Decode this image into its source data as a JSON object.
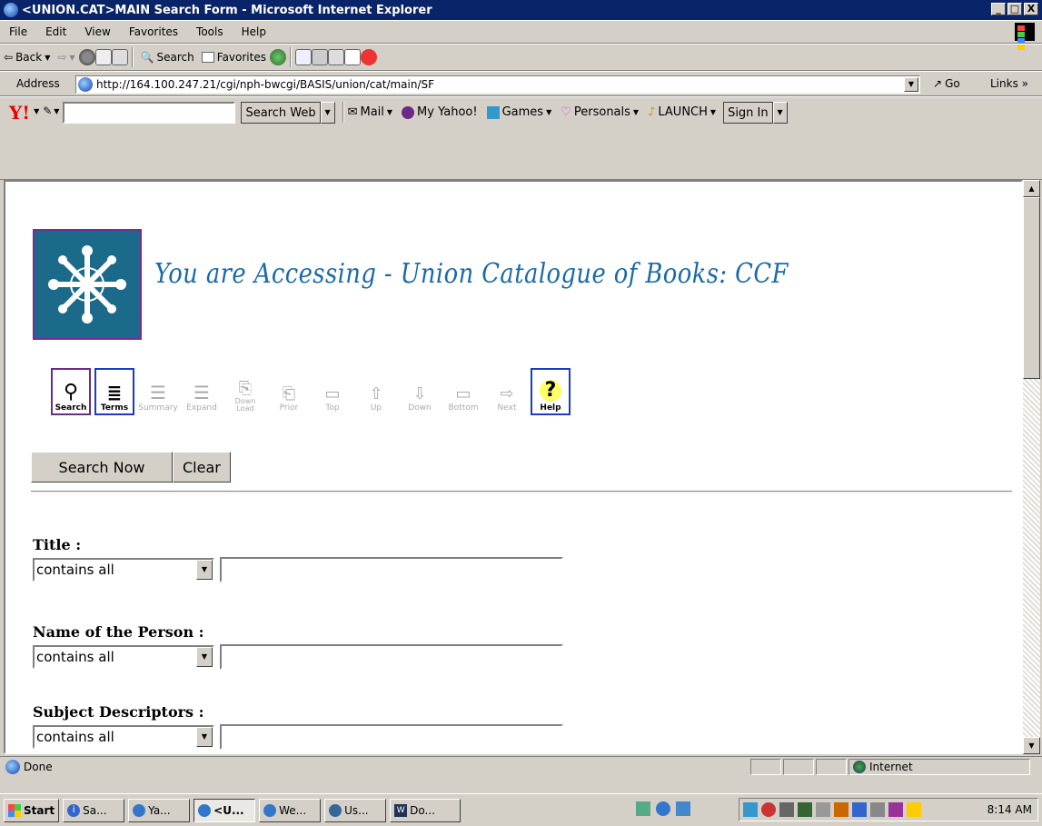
{
  "window": {
    "title": "<UNION.CAT>MAIN Search Form - Microsoft Internet Explorer",
    "min": "_",
    "max": "□",
    "close": "X"
  },
  "menu": [
    "File",
    "Edit",
    "View",
    "Favorites",
    "Tools",
    "Help"
  ],
  "toolbar": {
    "back": "Back",
    "search": "Search",
    "favorites": "Favorites"
  },
  "address": {
    "label": "Address",
    "url": "http://164.100.247.21/cgi/nph-bwcgi/BASIS/union/cat/main/SF",
    "go": "Go",
    "links": "Links"
  },
  "yahoo": {
    "logo": "Y!",
    "search_web": "Search Web",
    "mail": "Mail",
    "my_yahoo": "My Yahoo!",
    "games": "Games",
    "personals": "Personals",
    "launch": "LAUNCH",
    "sign_in": "Sign In"
  },
  "page": {
    "heading": "You are Accessing - Union Catalogue of Books: CCF",
    "tools": [
      {
        "label": "Search",
        "active": true
      },
      {
        "label": "Terms",
        "active": true
      },
      {
        "label": "Summary",
        "active": false
      },
      {
        "label": "Expand",
        "active": false
      },
      {
        "label": "Down Load",
        "active": false
      },
      {
        "label": "Prior",
        "active": false
      },
      {
        "label": "Top",
        "active": false
      },
      {
        "label": "Up",
        "active": false
      },
      {
        "label": "Down",
        "active": false
      },
      {
        "label": "Bottom",
        "active": false
      },
      {
        "label": "Next",
        "active": false
      },
      {
        "label": "Help",
        "active": true
      }
    ],
    "search_now": "Search Now",
    "clear": "Clear",
    "fields": [
      {
        "label": "Title :",
        "mode": "contains all",
        "value": ""
      },
      {
        "label": "Name of the Person :",
        "mode": "contains all",
        "value": ""
      },
      {
        "label": "Subject Descriptors :",
        "mode": "contains all",
        "value": ""
      }
    ]
  },
  "status": {
    "text": "Done",
    "zone": "Internet"
  },
  "taskbar": {
    "start": "Start",
    "tasks": [
      "Sa...",
      "Ya...",
      "<U...",
      "We...",
      "Us...",
      "Do..."
    ],
    "clock": "8:14 AM"
  }
}
